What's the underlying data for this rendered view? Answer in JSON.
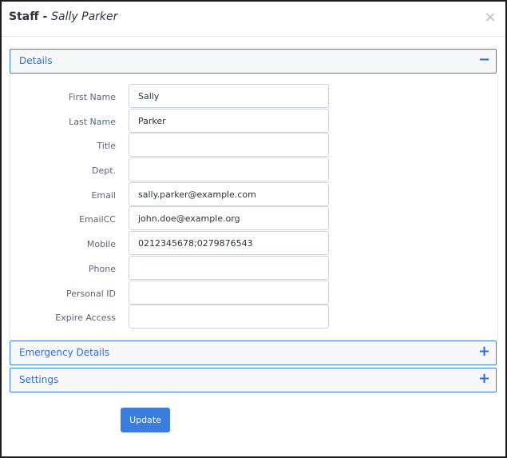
{
  "dialog": {
    "title_prefix": "Staff",
    "title_separator": " - ",
    "title_name": "Sally Parker",
    "close_glyph": "×"
  },
  "panels": {
    "details": {
      "title": "Details",
      "toggle": "−",
      "state": "expanded"
    },
    "emergency": {
      "title": "Emergency Details",
      "toggle": "+",
      "state": "collapsed"
    },
    "settings": {
      "title": "Settings",
      "toggle": "+",
      "state": "collapsed"
    }
  },
  "fields": [
    {
      "label": "First Name",
      "value": "Sally",
      "placeholder": ""
    },
    {
      "label": "Last Name",
      "value": "Parker",
      "placeholder": ""
    },
    {
      "label": "Title",
      "value": "",
      "placeholder": ""
    },
    {
      "label": "Dept.",
      "value": "",
      "placeholder": ""
    },
    {
      "label": "Email",
      "value": "sally.parker@example.com",
      "placeholder": ""
    },
    {
      "label": "EmailCC",
      "value": "john.doe@example.org",
      "placeholder": ""
    },
    {
      "label": "Mobile",
      "value": "0212345678;0279876543",
      "placeholder": ""
    },
    {
      "label": "Phone",
      "value": "",
      "placeholder": ""
    },
    {
      "label": "Personal ID",
      "value": "",
      "placeholder": ""
    },
    {
      "label": "Expire Access",
      "value": "",
      "placeholder": ""
    }
  ],
  "actions": {
    "update_label": "Update"
  },
  "colors": {
    "accent": "#3b7ddd",
    "panel_background": "#f6f7f9",
    "label_text": "#5d6478",
    "input_border": "#ced3dc"
  }
}
